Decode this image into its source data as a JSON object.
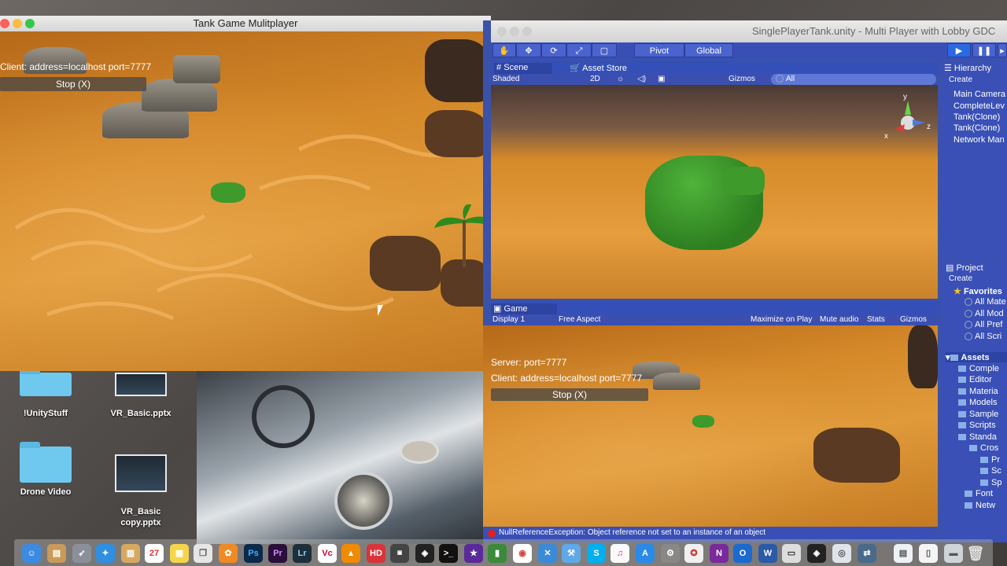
{
  "desktop": {
    "icons": [
      {
        "label": "!UnityStuff"
      },
      {
        "label": "VR_Basic.pptx"
      },
      {
        "label": "Drone Video"
      },
      {
        "label": "VR_Basic\ncopy.pptx"
      }
    ]
  },
  "game_window": {
    "title": "Tank Game Mulitplayer",
    "client_text": "Client: address=localhost port=7777",
    "stop_label": "Stop (X)"
  },
  "unity": {
    "title": "SinglePlayerTank.unity - Multi Player with Lobby GDC",
    "toolbar": {
      "pivot": "Pivot",
      "global": "Global"
    },
    "scene": {
      "tab": "Scene",
      "asset_store_tab": "Asset Store",
      "shaded": "Shaded",
      "mode_2d": "2D",
      "gizmos": "Gizmos",
      "search_placeholder": "All",
      "axis_x": "x",
      "axis_y": "y",
      "axis_z": "z"
    },
    "game": {
      "tab": "Game",
      "display": "Display 1",
      "aspect": "Free Aspect",
      "maximize": "Maximize on Play",
      "mute": "Mute audio",
      "stats": "Stats",
      "gizmos": "Gizmos",
      "server_text": "Server: port=7777",
      "client_text": "Client: address=localhost port=7777",
      "stop_label": "Stop (X)"
    },
    "hierarchy": {
      "tab": "Hierarchy",
      "create": "Create",
      "items": [
        "Main Camera",
        "CompleteLev",
        "Tank(Clone)",
        "Tank(Clone)",
        "Network Man"
      ]
    },
    "project": {
      "tab": "Project",
      "create": "Create",
      "favorites": "Favorites",
      "favorites_items": [
        "All Mate",
        "All Mod",
        "All Pref",
        "All Scri"
      ],
      "assets": "Assets",
      "assets_items": [
        "Comple",
        "Editor",
        "Materia",
        "Models",
        "Sample",
        "Scripts",
        "Standa",
        "Cros",
        "Pr",
        "Sc",
        "Sp",
        "Font",
        "Netw"
      ]
    },
    "console_message": "NullReferenceException: Object reference not set to an instance of an object"
  },
  "dock": {
    "icons": [
      "finder-icon",
      "launchpad-icon",
      "safari-icon",
      "notes-icon",
      "calendar-icon",
      "photoshop-icon",
      "premiere-icon",
      "lightroom-icon",
      "vlc-icon",
      "unity-icon",
      "terminal-icon",
      "chrome-icon",
      "skype-icon",
      "itunes-icon",
      "app-store-icon",
      "system-preferences-icon",
      "onenote-icon",
      "outlook-icon",
      "word-icon",
      "trash-icon"
    ],
    "labels": {
      "ps": "Ps",
      "pr": "Pr",
      "lr": "Lr",
      "cal": "27",
      "hd": "HD"
    }
  }
}
